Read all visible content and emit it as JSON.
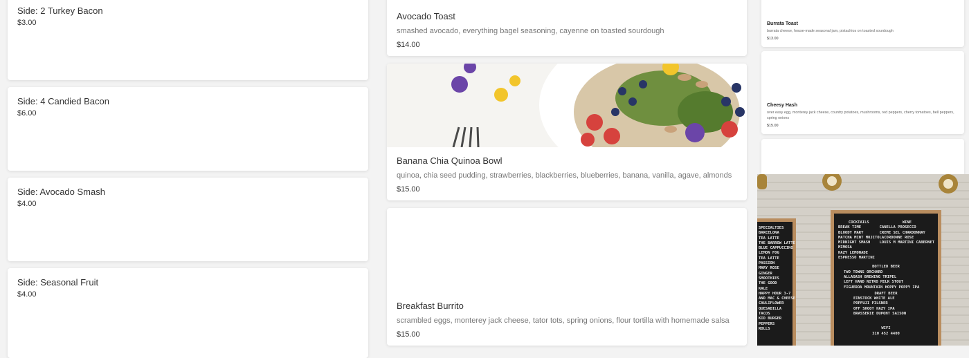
{
  "left_items": [
    {
      "title": "Side: 2 Turkey Bacon",
      "price": "$3.00"
    },
    {
      "title": "Side: 4 Candied Bacon",
      "price": "$6.00"
    },
    {
      "title": "Side: Avocado Smash",
      "price": "$4.00"
    },
    {
      "title": "Side: Seasonal Fruit",
      "price": "$4.00"
    }
  ],
  "middle_items": [
    {
      "title": "Avocado Toast",
      "desc": "smashed avocado, everything bagel seasoning, cayenne on toasted sourdough",
      "price": "$14.00"
    },
    {
      "title": "Banana Chia Quinoa Bowl",
      "desc": "quinoa, chia seed pudding, strawberries, blackberries, blueberries, banana, vanilla, agave, almonds",
      "price": "$15.00"
    },
    {
      "title": "Breakfast Burrito",
      "desc": "scrambled eggs, monterey jack cheese, tator tots, spring onions, flour tortilla with homemade salsa",
      "price": "$15.00"
    }
  ],
  "right_items": [
    {
      "title": "Burrata Toast",
      "desc": "burrata cheese, house-made seasonal jam, pistachios on toasted sourdough",
      "price": "$13.00"
    },
    {
      "title": "Cheesy Hash",
      "desc": "over easy egg, monterey jack cheese, country potatoes, mushrooms, red peppers, cherry tomatoes, bell peppers, spring onions",
      "price": "$15.00"
    }
  ],
  "board_left": [
    "SPECIALTIES",
    "BARCELONA",
    "TEA LATTE",
    "THE BARROW LATTE",
    "BLUE CAPPUCCINO",
    "LEMON FOG",
    "TEA LATTE",
    "PASSION",
    "MARY ROSE",
    "GINGER",
    "SMOOTHIES",
    "THE GOOD",
    "KALE",
    "HAPPY HOUR 3-7",
    "AND MAC & CHEESE",
    "CAULIFLOWER",
    "QUESADILLA",
    "TACOS",
    "KID BURGER",
    "PEPPERS",
    "ROLLS"
  ],
  "board_right": {
    "cocktails_head": "COCKTAILS",
    "cocktails": [
      "BREAK TIME",
      "BLOODY MARY",
      "MATCHA MINT MOJITO",
      "MIDNIGHT SMASH",
      "MIMOSA",
      "HAZY LEMONADE",
      "ESPRESSO MARTINI"
    ],
    "wine_head": "WINE",
    "wine": [
      "CANELLA PROSECCO",
      "CREME SEL CHARDONNAY",
      "LACORDONNE ROSE",
      "LOUIS M MARTINI CABERNET"
    ],
    "bottled_head": "BOTTLED BEER",
    "bottled": [
      "TWO TOWNS ORCHARD",
      "ALLAGASH BREWING TRIPEL",
      "LEFT HAND NITRO MILK STOUT",
      "FIGUEROA MOUNTAIN HOPPY POPPY IPA"
    ],
    "draft_head": "DRAFT BEER",
    "draft": [
      "EINSTOCK WHITE ALE",
      "POPFUJI PILSNER",
      "OFF SHOOT HAZY IPA",
      "BRASSERIE DUPONT SAISON"
    ],
    "wifi_head": "WIFI",
    "wifi": "310 452 4400"
  }
}
